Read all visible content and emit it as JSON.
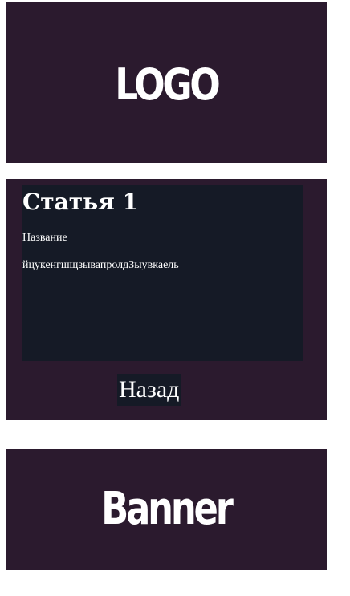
{
  "header": {
    "logo_text": "LOGO"
  },
  "article": {
    "title": "Статья 1",
    "name_label": "Название",
    "body_text": "йцукенгшщзывапролдЗыувкаель",
    "back_button_label": "Назад"
  },
  "banner": {
    "text": "Banner"
  },
  "colors": {
    "section_background": "#2b1a2e",
    "card_background": "#151a26",
    "text": "#ffffff",
    "page_background": "#ffffff"
  }
}
